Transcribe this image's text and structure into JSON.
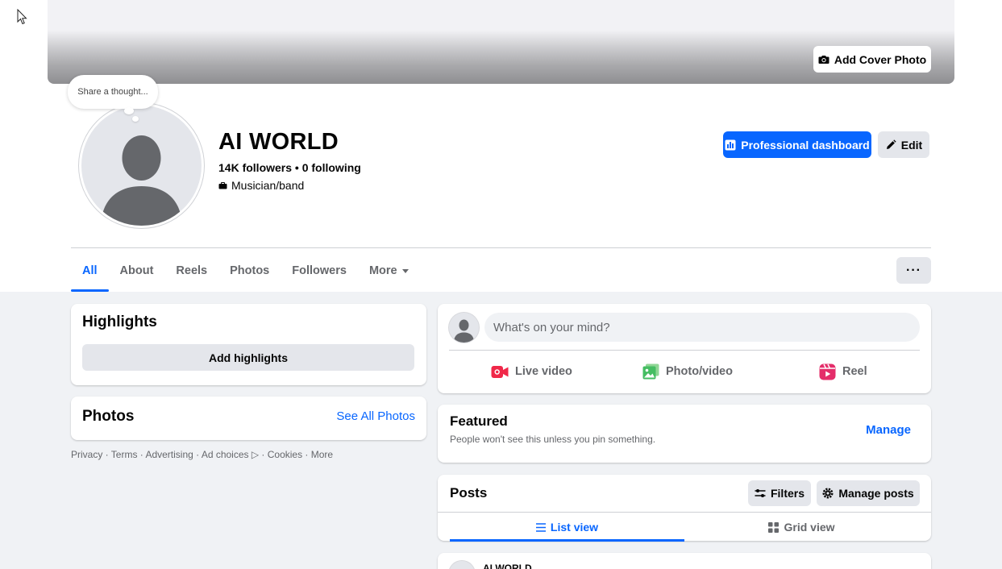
{
  "cover": {
    "add_cover_label": "Add Cover Photo"
  },
  "thought_bubble": {
    "text": "Share a thought..."
  },
  "profile": {
    "name": "AI WORLD",
    "followers_line": "14K followers • 0 following",
    "category": "Musician/band"
  },
  "actions": {
    "pro_dashboard": "Professional dashboard",
    "edit": "Edit",
    "more_options": "···"
  },
  "tabs": [
    {
      "label": "All",
      "active": true
    },
    {
      "label": "About"
    },
    {
      "label": "Reels"
    },
    {
      "label": "Photos"
    },
    {
      "label": "Followers"
    },
    {
      "label": "More"
    }
  ],
  "highlights": {
    "title": "Highlights",
    "add_label": "Add highlights"
  },
  "photos": {
    "title": "Photos",
    "see_all": "See All Photos"
  },
  "footer": {
    "text": "Privacy · Terms · Advertising · Ad choices ▷ · Cookies · More"
  },
  "composer": {
    "placeholder": "What's on your mind?",
    "live_video": "Live video",
    "photo_video": "Photo/video",
    "reel": "Reel"
  },
  "featured": {
    "title": "Featured",
    "subtitle": "People won't see this unless you pin something.",
    "manage": "Manage"
  },
  "posts": {
    "title": "Posts",
    "filters": "Filters",
    "manage_posts": "Manage posts",
    "list_view": "List view",
    "grid_view": "Grid view"
  },
  "post_preview": {
    "author": "AI WORLD"
  },
  "colors": {
    "primary_blue": "#0866ff",
    "background": "#f0f2f5",
    "button_gray": "#e4e6eb"
  }
}
